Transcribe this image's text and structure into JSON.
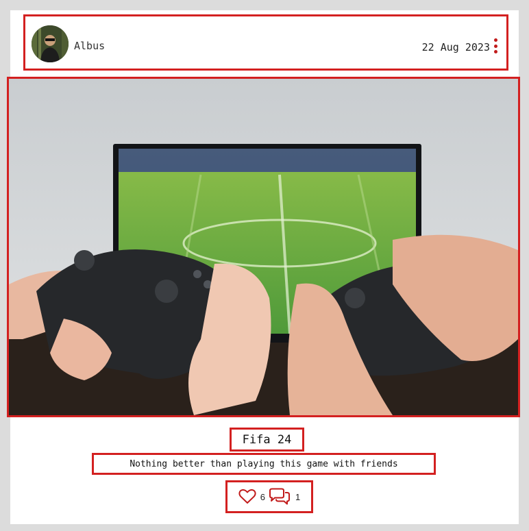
{
  "post": {
    "author": "Albus",
    "date": "22 Aug 2023",
    "title": "Fifa 24",
    "description": "Nothing better than playing this game with friends",
    "likes": "6",
    "comments": "1"
  },
  "icons": {
    "like": "heart-icon",
    "comment": "comment-bubbles-icon",
    "menu": "more-vertical-icon"
  },
  "colors": {
    "outline": "#d32020",
    "menu_dots": "#c11a1a",
    "page_bg": "#dcdcdc",
    "card_bg": "#ffffff"
  }
}
